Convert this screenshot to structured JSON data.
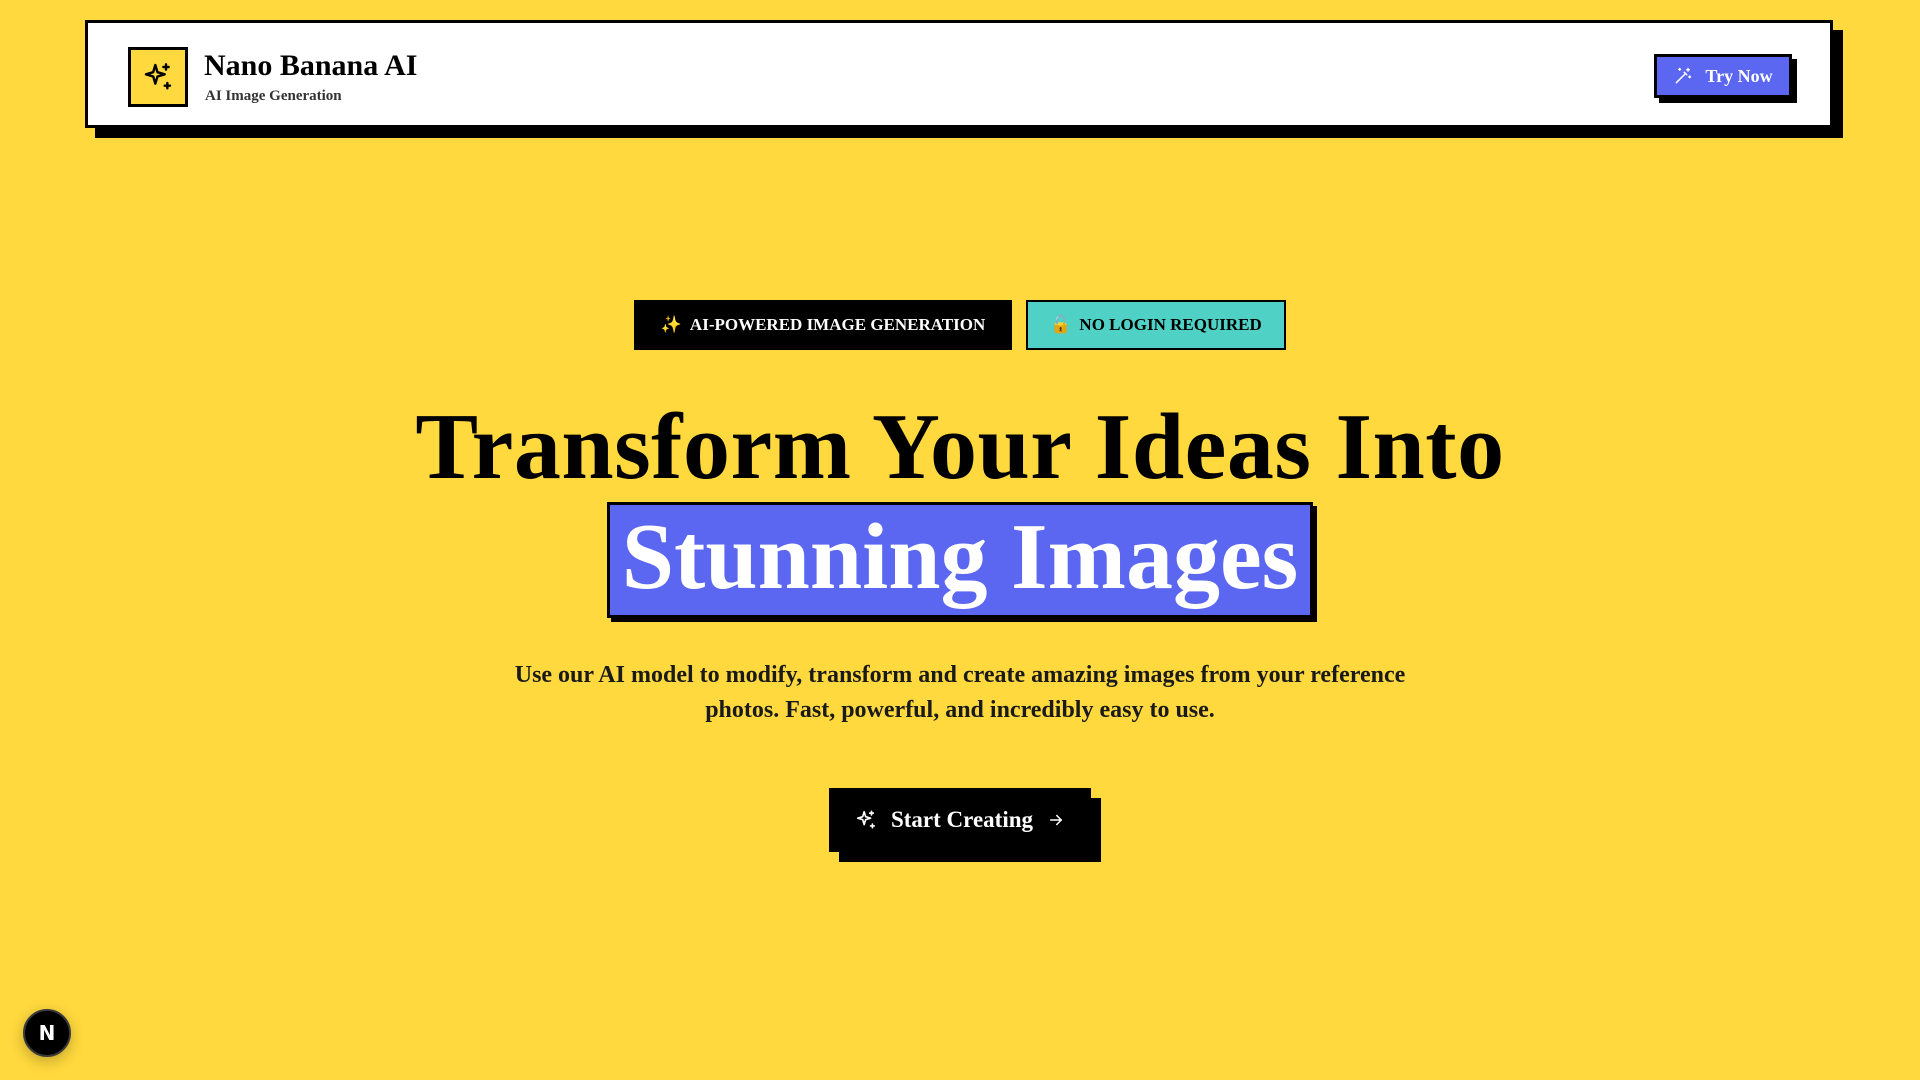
{
  "colors": {
    "background": "#FFD93D",
    "accent_blue": "#5B67F1",
    "accent_teal": "#4FD1C5",
    "ink": "#000000",
    "white": "#FFFFFF"
  },
  "header": {
    "logo_icon": "sparkles-icon",
    "brand_name": "Nano Banana AI",
    "brand_subtitle": "AI Image Generation",
    "try_button": {
      "icon": "magic-wand-icon",
      "label": "Try Now"
    }
  },
  "hero": {
    "badges": [
      {
        "icon": "sparkles-emoji",
        "glyph": "✨",
        "label": "AI-POWERED IMAGE GENERATION"
      },
      {
        "icon": "unlock-emoji",
        "glyph": "🔓",
        "label": "NO LOGIN REQUIRED"
      }
    ],
    "headline_line1": "Transform Your Ideas Into",
    "headline_highlight": "Stunning Images",
    "description": "Use our AI model to modify, transform and create amazing images from your reference photos. Fast, powerful, and incredibly easy to use.",
    "cta": {
      "icon": "sparkles-icon",
      "label": "Start Creating",
      "trailing_icon": "arrow-right-icon"
    }
  },
  "dev_badge": {
    "label": "N",
    "icon": "nextjs-icon"
  }
}
